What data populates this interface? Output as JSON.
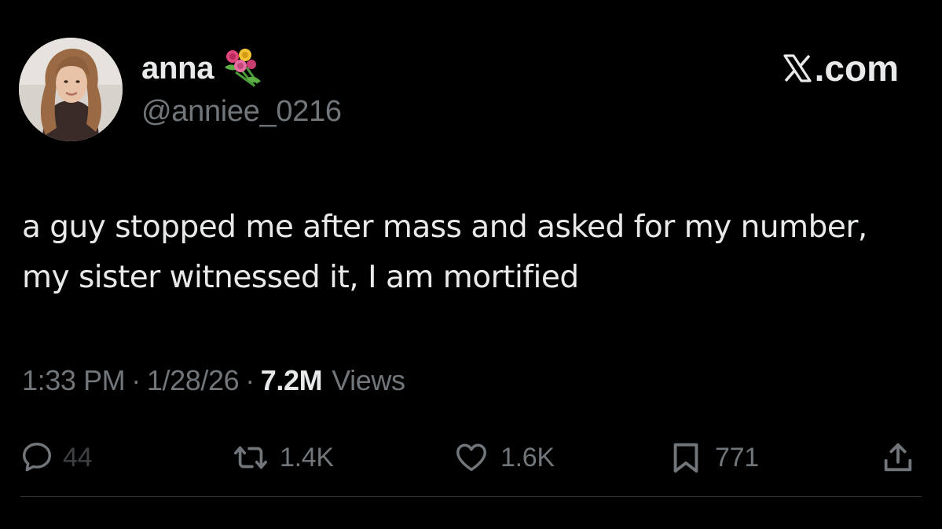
{
  "author": {
    "display_name": "anna",
    "name_emoji": "bouquet-icon",
    "handle": "@anniee_0216"
  },
  "brand": {
    "text": ".com",
    "logo": "x-logo-icon"
  },
  "tweet": {
    "text": "a guy stopped me after mass and asked for my number, my sister witnessed it, I am mortified"
  },
  "meta": {
    "time": "1:33 PM",
    "separator": "·",
    "date": "1/28/26",
    "views_count": "7.2M",
    "views_label": "Views"
  },
  "actions": {
    "replies": {
      "icon": "reply-icon",
      "count": "44"
    },
    "reposts": {
      "icon": "repost-icon",
      "count": "1.4K"
    },
    "likes": {
      "icon": "heart-icon",
      "count": "1.6K"
    },
    "bookmarks": {
      "icon": "bookmark-icon",
      "count": "771"
    },
    "share": {
      "icon": "share-icon"
    }
  },
  "colors": {
    "background": "#000000",
    "primary_text": "#e7e9ea",
    "secondary_text": "#71767b",
    "divider": "#2f3336"
  }
}
